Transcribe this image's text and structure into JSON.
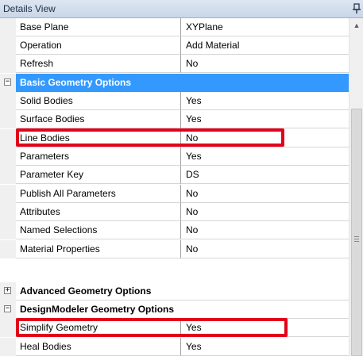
{
  "panel": {
    "title": "Details View",
    "pin_glyph": "pin-icon"
  },
  "rows": {
    "base_plane": {
      "name": "Base Plane",
      "value": "XYPlane"
    },
    "operation": {
      "name": "Operation",
      "value": "Add Material"
    },
    "refresh": {
      "name": "Refresh",
      "value": "No"
    },
    "solid_bodies": {
      "name": "Solid Bodies",
      "value": "Yes"
    },
    "surface_bodies": {
      "name": "Surface Bodies",
      "value": "Yes"
    },
    "line_bodies": {
      "name": "Line Bodies",
      "value": "No"
    },
    "parameters": {
      "name": "Parameters",
      "value": "Yes"
    },
    "parameter_key": {
      "name": "Parameter Key",
      "value": "DS"
    },
    "publish_all_parameters": {
      "name": "Publish All Parameters",
      "value": "No"
    },
    "attributes": {
      "name": "Attributes",
      "value": "No"
    },
    "named_selections": {
      "name": "Named Selections",
      "value": "No"
    },
    "material_properties": {
      "name": "Material Properties",
      "value": "No"
    },
    "simplify_geometry": {
      "name": "Simplify Geometry",
      "value": "Yes"
    },
    "heal_bodies": {
      "name": "Heal Bodies",
      "value": "Yes"
    }
  },
  "groups": {
    "basic": {
      "label": "Basic Geometry Options",
      "toggle": "−"
    },
    "advanced": {
      "label": "Advanced Geometry Options",
      "toggle": "+"
    },
    "designmodeler": {
      "label": "DesignModeler Geometry Options",
      "toggle": "−"
    }
  },
  "scrollbar": {
    "up_arrow": "▲"
  },
  "colors": {
    "selection": "#3399ff",
    "highlight": "#e3001b"
  }
}
